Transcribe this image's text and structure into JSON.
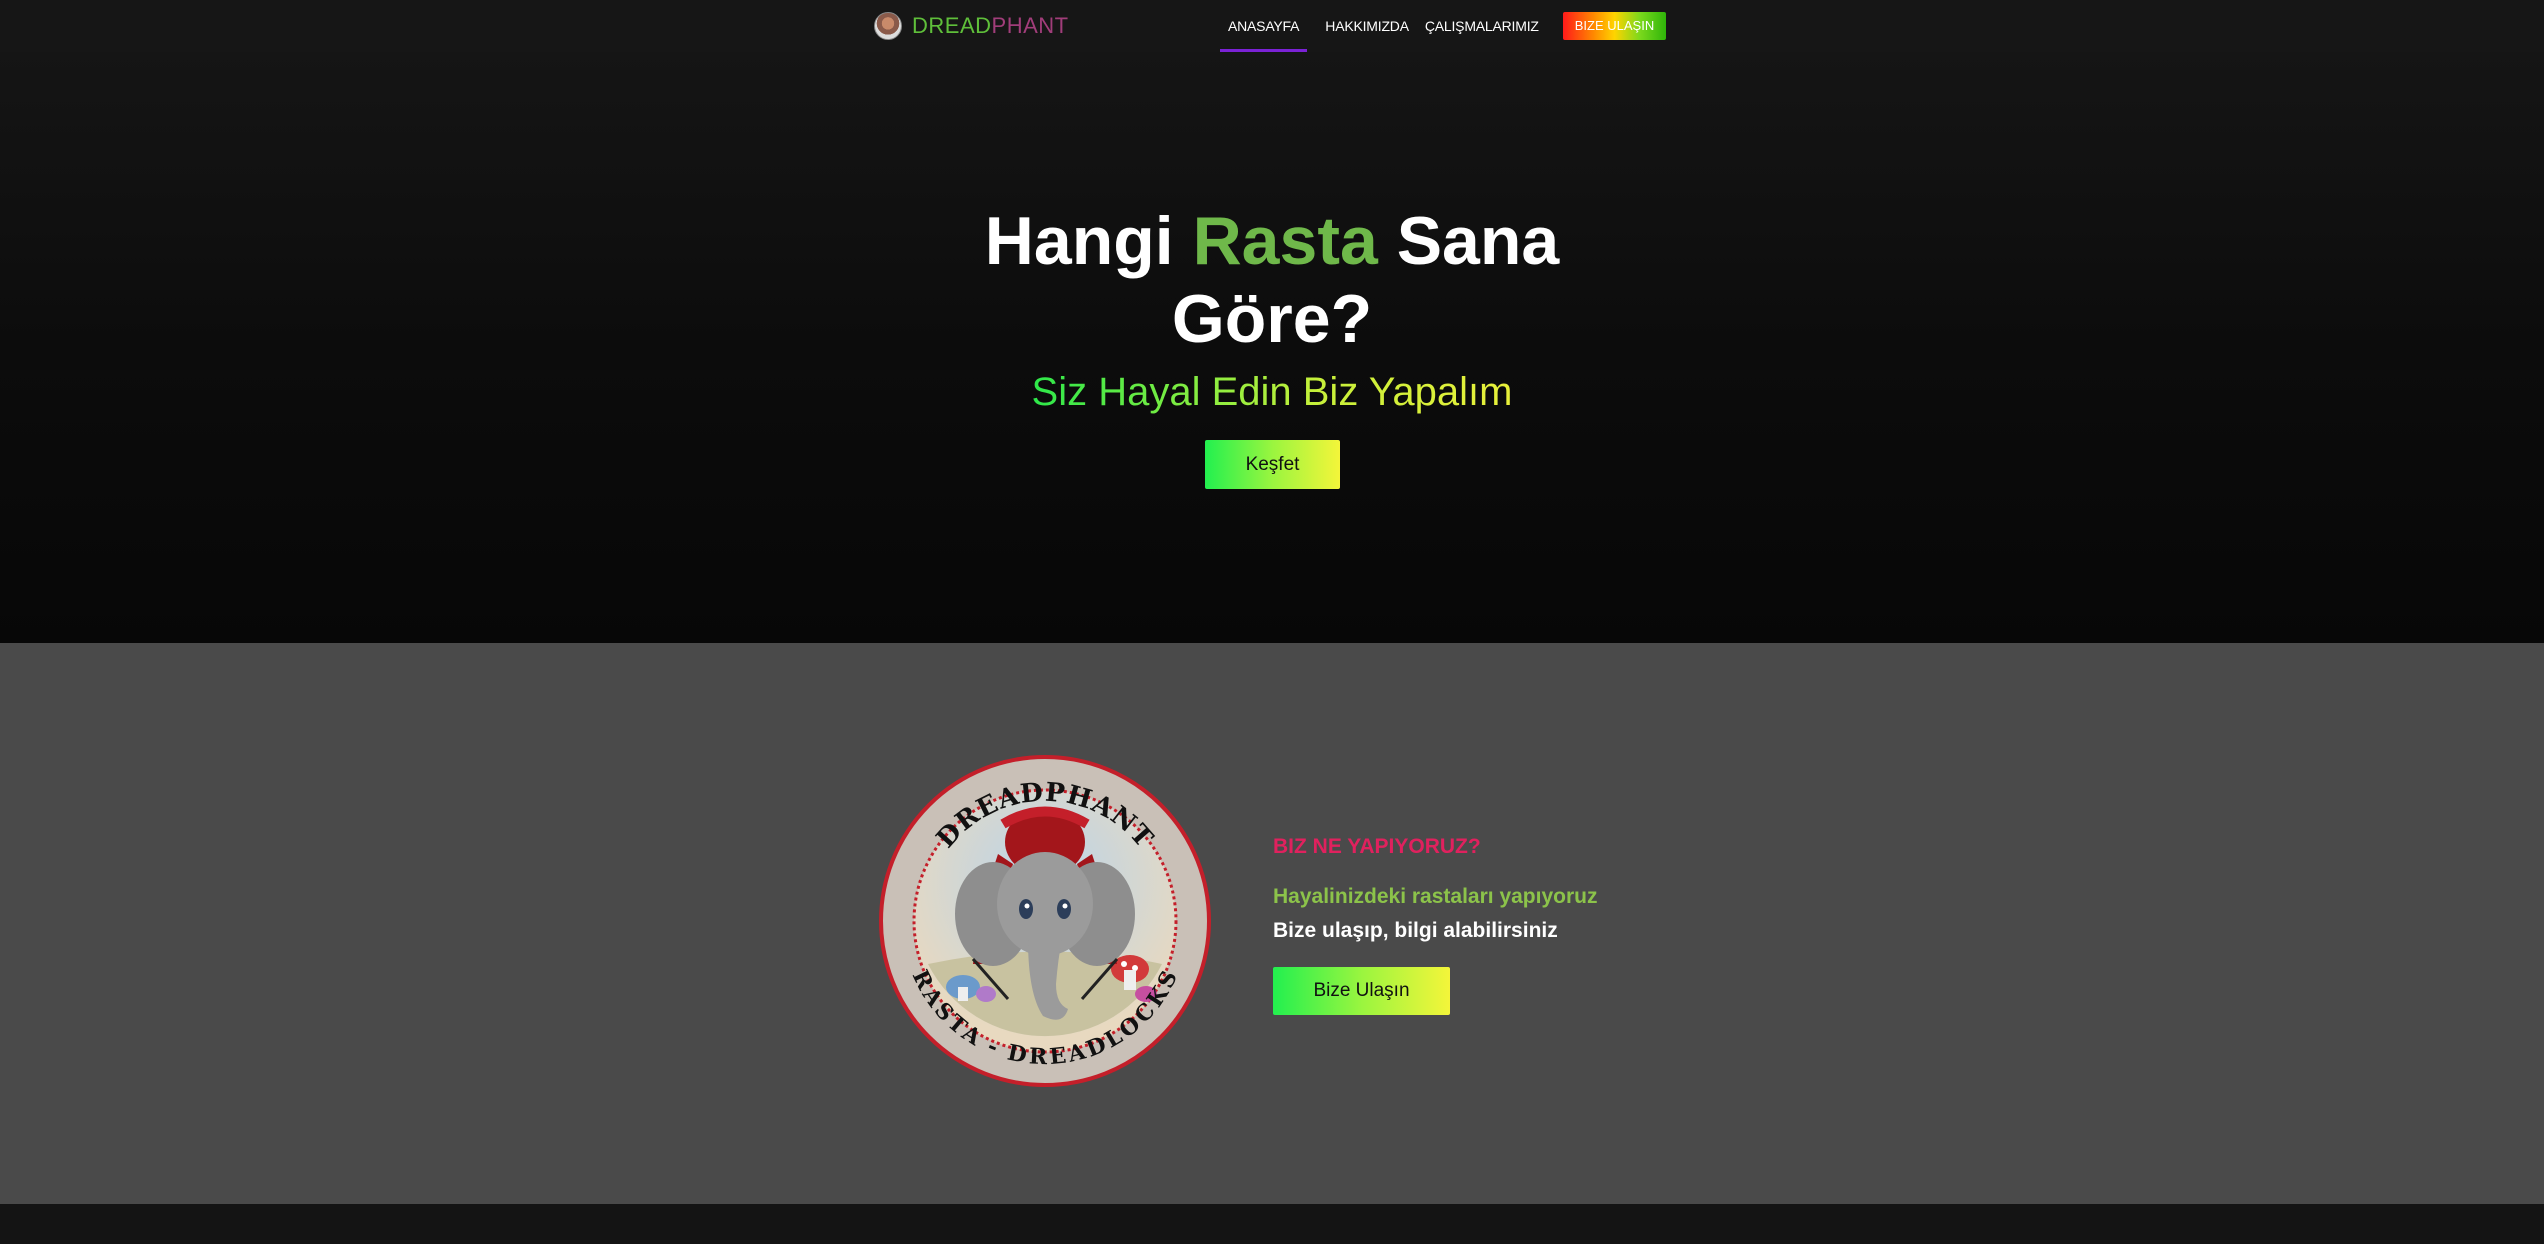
{
  "navbar": {
    "brand_part1": "DREAD",
    "brand_part2": "PHANT",
    "logo_icon": "elephant-avatar-icon",
    "links": [
      "ANASAYFA",
      "HAKKIMIZDA",
      "ÇALIŞMALARIMIZ"
    ],
    "active_link": "ANASAYFA",
    "cta_label": "BIZE ULAŞIN",
    "colors": {
      "active_underline": "#7b22d6",
      "brand_green": "#5fbf3a",
      "brand_purple": "#a13d7a"
    }
  },
  "hero": {
    "title_before": "Hangi ",
    "title_accent": "Rasta",
    "title_after": " Sana",
    "title_line2": "Göre?",
    "subtitle": "Siz Hayal Edin Biz Yapalım",
    "button_label": "Keşfet",
    "colors": {
      "accent": "#6fb84a"
    }
  },
  "about": {
    "badge_top_text": "DREADPHANT",
    "badge_bottom_text": "RASTA - DREADLOCKS",
    "heading": "BIZ NE YAPIYORUZ?",
    "line1": "Hayalinizdeki rastaları yapıyoruz",
    "line2": "Bize ulaşıp, bilgi alabilirsiniz",
    "button_label": "Bize Ulaşın",
    "colors": {
      "heading": "#e0215e",
      "line1": "#8cc34a"
    }
  }
}
